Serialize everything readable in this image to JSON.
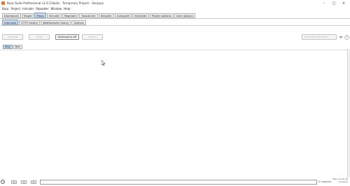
{
  "window": {
    "title": "Burp Suite Professional v2.0.11beta - Temporary Project - Sanjaya"
  },
  "menu": [
    "Burp",
    "Project",
    "Intruder",
    "Repeater",
    "Window",
    "Help"
  ],
  "main_tabs": [
    {
      "label": "Dashboard",
      "active": false
    },
    {
      "label": "Target",
      "active": false
    },
    {
      "label": "Proxy",
      "active": true
    },
    {
      "label": "Intruder",
      "active": false
    },
    {
      "label": "Repeater",
      "active": false
    },
    {
      "label": "Sequencer",
      "active": false
    },
    {
      "label": "Decoder",
      "active": false
    },
    {
      "label": "Comparer",
      "active": false
    },
    {
      "label": "Extender",
      "active": false
    },
    {
      "label": "Project options",
      "active": false
    },
    {
      "label": "User options",
      "active": false
    }
  ],
  "proxy_tabs": [
    {
      "label": "Intercept",
      "active": true
    },
    {
      "label": "HTTP history",
      "active": false
    },
    {
      "label": "WebSockets history",
      "active": false
    },
    {
      "label": "Options",
      "active": false
    }
  ],
  "toolbar": {
    "forward": "Forward",
    "drop": "Drop",
    "intercept": "Intercept is off",
    "action": "Action",
    "comment_placeholder": "Comment this item"
  },
  "editor_tabs": [
    {
      "label": "Raw",
      "active": true
    },
    {
      "label": "Hex",
      "active": false
    }
  ],
  "footer": {
    "help": "?",
    "prev": "<",
    "add": "+",
    "next": ">",
    "search_value": "",
    "matches": "0 matches"
  },
  "tray": {
    "line1": "ENG  10:26 AM",
    "line2": "1/1/2019"
  }
}
